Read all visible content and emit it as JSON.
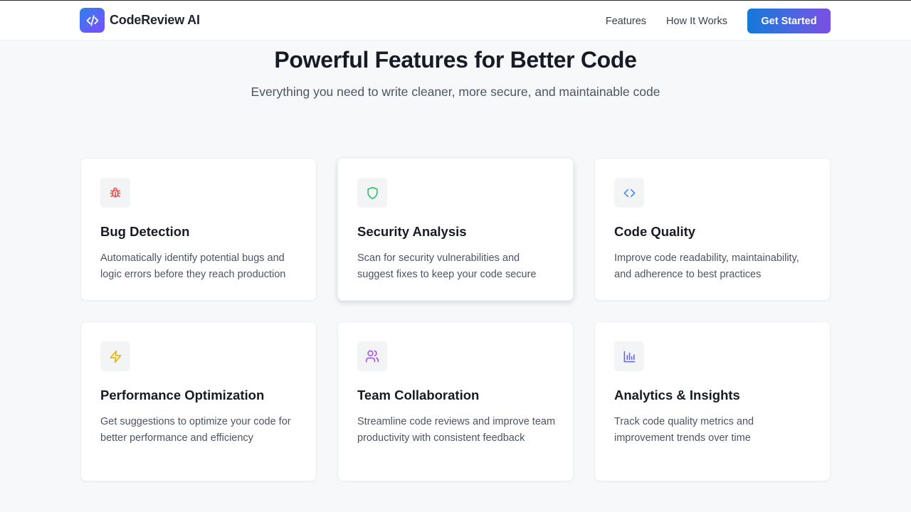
{
  "nav": {
    "brand": "CodeReview AI",
    "links": [
      "Features",
      "How It Works"
    ],
    "cta_label": "Get Started"
  },
  "hero": {
    "title": "Powerful Features for Better Code",
    "subtitle": "Everything you need to write cleaner, more secure, and maintainable code"
  },
  "features": [
    {
      "title": "Bug Detection",
      "description": "Automatically identify potential bugs and logic errors before they reach production",
      "icon": "bug-icon",
      "icon_color": "#ef4444"
    },
    {
      "title": "Security Analysis",
      "description": "Scan for security vulnerabilities and suggest fixes to keep your code secure",
      "icon": "shield-icon",
      "icon_color": "#22c55e"
    },
    {
      "title": "Code Quality",
      "description": "Improve code readability, maintainability, and adherence to best practices",
      "icon": "code-icon",
      "icon_color": "#3b82f6"
    },
    {
      "title": "Performance Optimization",
      "description": "Get suggestions to optimize your code for better performance and efficiency",
      "icon": "zap-icon",
      "icon_color": "#eab308"
    },
    {
      "title": "Team Collaboration",
      "description": "Streamline code reviews and improve team productivity with consistent feedback",
      "icon": "users-icon",
      "icon_color": "#a855f7"
    },
    {
      "title": "Analytics & Insights",
      "description": "Track code quality metrics and improvement trends over time",
      "icon": "bar-chart-icon",
      "icon_color": "#6366f1"
    }
  ],
  "colors": {
    "brand_gradient_start": "#2f80ed",
    "brand_gradient_end": "#7c4dff",
    "cta_gradient_start": "#1479d8",
    "cta_gradient_end": "#7b4fe3",
    "page_background": "#f7f8fa"
  }
}
